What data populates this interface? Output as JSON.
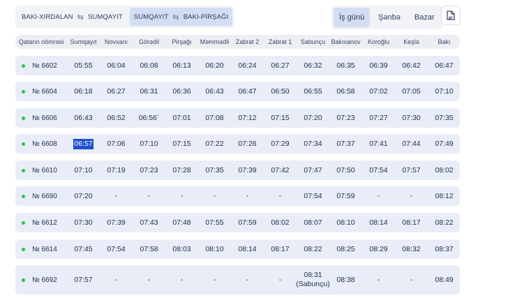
{
  "route_tabs": [
    {
      "from": "BAKI-XIRDALAN",
      "to": "SUMQAYIT",
      "active": false
    },
    {
      "from": "SUMQAYIT",
      "to": "BAKI-PİRŞAĞI",
      "active": true
    }
  ],
  "day_tabs": [
    {
      "label": "İş günü",
      "active": true
    },
    {
      "label": "Şənbə",
      "active": false
    },
    {
      "label": "Bazar",
      "active": false
    }
  ],
  "pdf_icon": "file-pdf-icon",
  "colors": {
    "accent": "#d3ddf3",
    "row_bg": "#e8edf7",
    "dot": "#2fbf4f",
    "highlight": "#1f4fd1"
  },
  "table": {
    "columns": [
      "Qatarın nömrəsi",
      "Sumqayıt",
      "Novxanı",
      "Görədil",
      "Pirşağı",
      "Məmmədli",
      "Zabrat 2",
      "Zabrat 1",
      "Sabunçu",
      "Bakıxanov",
      "Koroğlu",
      "Keşlə",
      "Bakı"
    ],
    "rows": [
      {
        "train": "№ 6602",
        "times": [
          "05:55",
          "06:04",
          "06:08",
          "06:13",
          "06:20",
          "06:24",
          "06:27",
          "06:32",
          "06:35",
          "06:39",
          "06:42",
          "06:47"
        ]
      },
      {
        "train": "№ 6604",
        "times": [
          "06:18",
          "06:27",
          "06:31",
          "06:36",
          "06:43",
          "06:47",
          "06:50",
          "06:55",
          "06:58",
          "07:02",
          "07:05",
          "07:10"
        ]
      },
      {
        "train": "№ 6606",
        "times": [
          "06:43",
          "06:52",
          "06:56`",
          "07:01",
          "07:08",
          "07:12",
          "07:15",
          "07:20",
          "07:23",
          "07:27",
          "07:30",
          "07:35"
        ]
      },
      {
        "train": "№ 6608",
        "times": [
          "06:57",
          "07:06",
          "07:10",
          "07:15",
          "07:22",
          "07:26",
          "07:29",
          "07:34",
          "07:37",
          "07:41",
          "07:44",
          "07:49"
        ]
      },
      {
        "train": "№ 6610",
        "times": [
          "07:10",
          "07:19",
          "07:23",
          "07:28",
          "07:35",
          "07:39",
          "07:42",
          "07:47",
          "07:50",
          "07:54",
          "07:57",
          "08:02"
        ]
      },
      {
        "train": "№ 6690",
        "times": [
          "07:20",
          "-",
          "-",
          "-",
          "-",
          "-",
          "-",
          "07:54",
          "07:59",
          "-",
          "-",
          "08:12"
        ]
      },
      {
        "train": "№ 6612",
        "times": [
          "07:30",
          "07:39",
          "07:43",
          "07:48",
          "07:55",
          "07:59",
          "08:02",
          "08:07",
          "08:10",
          "08:14",
          "08:17",
          "08:22"
        ]
      },
      {
        "train": "№ 6614",
        "times": [
          "07:45",
          "07:54",
          "07:58",
          "08:03",
          "08:10",
          "08:14",
          "08:17",
          "08:22",
          "08:25",
          "08:29",
          "08:32",
          "08:37"
        ]
      },
      {
        "train": "№ 6692",
        "times": [
          "07:57",
          "-",
          "-",
          "-",
          "-",
          "-",
          "-",
          "08:31\n(Sabunçu)",
          "08:38",
          "-",
          "-",
          "08:49"
        ]
      }
    ]
  },
  "selected_time": "06:57"
}
